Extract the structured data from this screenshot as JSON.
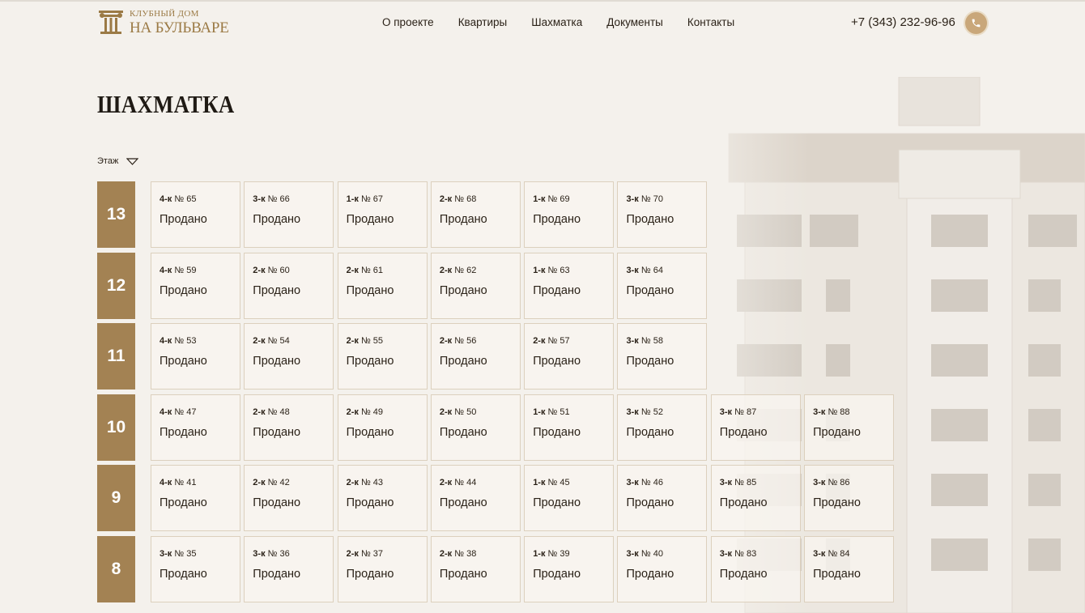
{
  "logo": {
    "line1": "КЛУБНЫЙ ДОМ",
    "line2": "НА БУЛЬВАРЕ",
    "icon": "column-icon"
  },
  "nav": [
    {
      "label": "О проекте"
    },
    {
      "label": "Квартиры"
    },
    {
      "label": "Шахматка"
    },
    {
      "label": "Документы"
    },
    {
      "label": "Контакты"
    }
  ],
  "phone": "+7 (343) 232-96-96",
  "phone_icon": "phone-icon",
  "title": "ШАХМАТКА",
  "filter": {
    "label": "Этаж",
    "icon": "chevron-down-icon"
  },
  "colors": {
    "accent": "#a38253",
    "background": "#f4f1ec",
    "logo": "#9b7a45"
  },
  "status_label": "Продано",
  "floors": [
    {
      "number": "13",
      "apartments": [
        {
          "type": "4-к",
          "number": "№ 65",
          "status": "Продано"
        },
        {
          "type": "3-к",
          "number": "№ 66",
          "status": "Продано"
        },
        {
          "type": "1-к",
          "number": "№ 67",
          "status": "Продано"
        },
        {
          "type": "2-к",
          "number": "№ 68",
          "status": "Продано"
        },
        {
          "type": "1-к",
          "number": "№ 69",
          "status": "Продано"
        },
        {
          "type": "3-к",
          "number": "№ 70",
          "status": "Продано"
        }
      ]
    },
    {
      "number": "12",
      "apartments": [
        {
          "type": "4-к",
          "number": "№ 59",
          "status": "Продано"
        },
        {
          "type": "2-к",
          "number": "№ 60",
          "status": "Продано"
        },
        {
          "type": "2-к",
          "number": "№ 61",
          "status": "Продано"
        },
        {
          "type": "2-к",
          "number": "№ 62",
          "status": "Продано"
        },
        {
          "type": "1-к",
          "number": "№ 63",
          "status": "Продано"
        },
        {
          "type": "3-к",
          "number": "№ 64",
          "status": "Продано"
        }
      ]
    },
    {
      "number": "11",
      "apartments": [
        {
          "type": "4-к",
          "number": "№ 53",
          "status": "Продано"
        },
        {
          "type": "2-к",
          "number": "№ 54",
          "status": "Продано"
        },
        {
          "type": "2-к",
          "number": "№ 55",
          "status": "Продано"
        },
        {
          "type": "2-к",
          "number": "№ 56",
          "status": "Продано"
        },
        {
          "type": "2-к",
          "number": "№ 57",
          "status": "Продано"
        },
        {
          "type": "3-к",
          "number": "№ 58",
          "status": "Продано"
        }
      ]
    },
    {
      "number": "10",
      "apartments": [
        {
          "type": "4-к",
          "number": "№ 47",
          "status": "Продано"
        },
        {
          "type": "2-к",
          "number": "№ 48",
          "status": "Продано"
        },
        {
          "type": "2-к",
          "number": "№ 49",
          "status": "Продано"
        },
        {
          "type": "2-к",
          "number": "№ 50",
          "status": "Продано"
        },
        {
          "type": "1-к",
          "number": "№ 51",
          "status": "Продано"
        },
        {
          "type": "3-к",
          "number": "№ 52",
          "status": "Продано"
        },
        {
          "type": "3-к",
          "number": "№ 87",
          "status": "Продано"
        },
        {
          "type": "3-к",
          "number": "№ 88",
          "status": "Продано"
        }
      ]
    },
    {
      "number": "9",
      "apartments": [
        {
          "type": "4-к",
          "number": "№ 41",
          "status": "Продано"
        },
        {
          "type": "2-к",
          "number": "№ 42",
          "status": "Продано"
        },
        {
          "type": "2-к",
          "number": "№ 43",
          "status": "Продано"
        },
        {
          "type": "2-к",
          "number": "№ 44",
          "status": "Продано"
        },
        {
          "type": "1-к",
          "number": "№ 45",
          "status": "Продано"
        },
        {
          "type": "3-к",
          "number": "№ 46",
          "status": "Продано"
        },
        {
          "type": "3-к",
          "number": "№ 85",
          "status": "Продано"
        },
        {
          "type": "3-к",
          "number": "№ 86",
          "status": "Продано"
        }
      ]
    },
    {
      "number": "8",
      "apartments": [
        {
          "type": "3-к",
          "number": "№ 35",
          "status": "Продано"
        },
        {
          "type": "3-к",
          "number": "№ 36",
          "status": "Продано"
        },
        {
          "type": "2-к",
          "number": "№ 37",
          "status": "Продано"
        },
        {
          "type": "2-к",
          "number": "№ 38",
          "status": "Продано"
        },
        {
          "type": "1-к",
          "number": "№ 39",
          "status": "Продано"
        },
        {
          "type": "3-к",
          "number": "№ 40",
          "status": "Продано"
        },
        {
          "type": "3-к",
          "number": "№ 83",
          "status": "Продано"
        },
        {
          "type": "3-к",
          "number": "№ 84",
          "status": "Продано"
        }
      ]
    }
  ]
}
